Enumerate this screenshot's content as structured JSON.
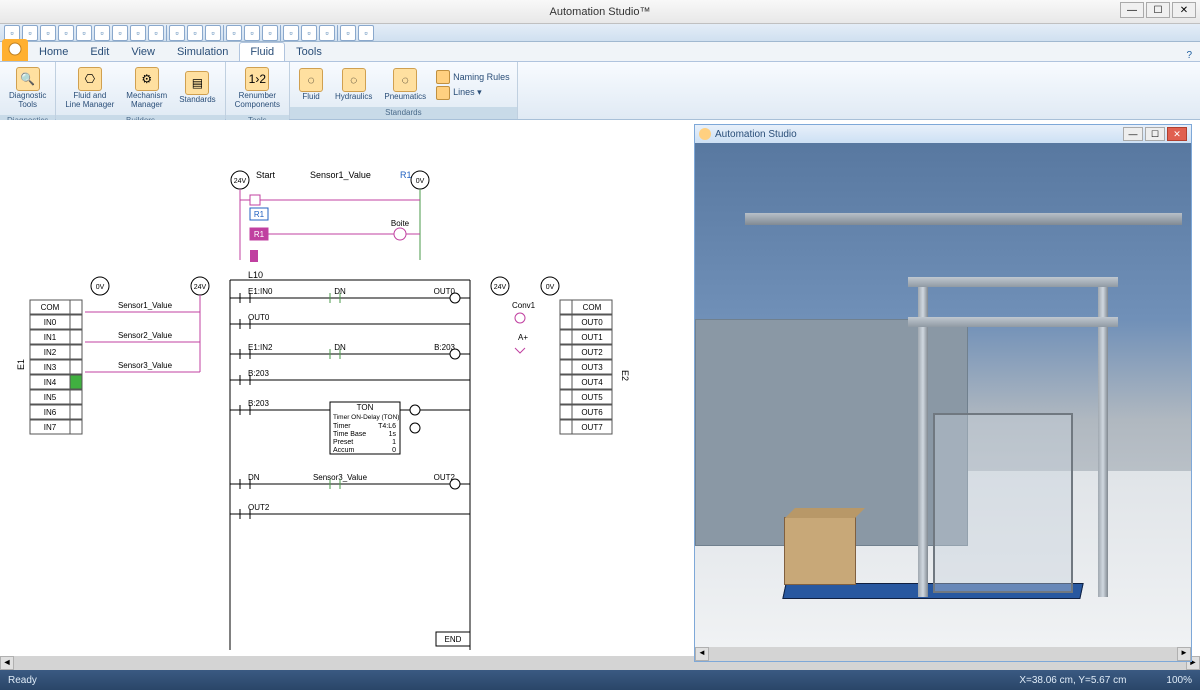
{
  "app": {
    "title": "Automation Studio™"
  },
  "window_controls": {
    "min": "—",
    "max": "☐",
    "close": "✕"
  },
  "qat_icons": [
    "new",
    "open",
    "save",
    "undo",
    "redo",
    "cut",
    "copy",
    "paste",
    "print",
    "sep",
    "zoom",
    "fit",
    "pan",
    "sep",
    "layer",
    "grid",
    "snap",
    "sep",
    "sim",
    "play",
    "stop",
    "sep",
    "opt",
    "help"
  ],
  "tabs": {
    "items": [
      "Home",
      "Edit",
      "View",
      "Simulation",
      "Fluid",
      "Tools"
    ],
    "active": "Fluid"
  },
  "ribbon": {
    "groups": [
      {
        "label": "Diagnostics",
        "buttons": [
          {
            "txt": "Diagnostic\nTools",
            "ico": "🔍"
          }
        ]
      },
      {
        "label": "Builders",
        "buttons": [
          {
            "txt": "Fluid and\nLine Manager",
            "ico": "⎔"
          },
          {
            "txt": "Mechanism\nManager",
            "ico": "⚙"
          },
          {
            "txt": "Standards",
            "ico": "▤"
          }
        ]
      },
      {
        "label": "Tools",
        "buttons": [
          {
            "txt": "Renumber\nComponents",
            "ico": "1›2"
          }
        ]
      },
      {
        "label": "Standards",
        "buttons": [
          {
            "txt": "Fluid",
            "ico": "◌"
          },
          {
            "txt": "Hydraulics",
            "ico": "◌"
          },
          {
            "txt": "Pneumatics",
            "ico": "◌"
          }
        ],
        "small": [
          {
            "txt": "Naming Rules",
            "ico": ""
          },
          {
            "txt": "Lines ▾",
            "ico": ""
          }
        ]
      }
    ]
  },
  "relay_panel": {
    "title": "Automation Studio"
  },
  "ladder": {
    "top": {
      "v24": "24V",
      "v0": "0V",
      "start": "Start",
      "sensor1": "Sensor1_Value",
      "r1": "R1",
      "boite": "Boite"
    },
    "module_left": {
      "title": "E1",
      "rows": [
        "COM",
        "IN0",
        "IN1",
        "IN2",
        "IN3",
        "IN4",
        "IN5",
        "IN6",
        "IN7"
      ],
      "sensors": [
        "Sensor1_Value",
        "Sensor2_Value",
        "Sensor3_Value"
      ]
    },
    "module_right": {
      "title": "E2",
      "rows": [
        "COM",
        "OUT0",
        "OUT1",
        "OUT2",
        "OUT3",
        "OUT4",
        "OUT5",
        "OUT6",
        "OUT7"
      ],
      "conv": "Conv1",
      "aplus": "A+"
    },
    "main": {
      "title": "L10",
      "rungs": [
        {
          "left": "E1:IN0",
          "mid": "DN",
          "right": "OUT0"
        },
        {
          "left": "OUT0"
        },
        {
          "left": "E1:IN2",
          "mid": "DN",
          "right": "B:203"
        },
        {
          "left": "B:203"
        },
        {
          "left": "B:203",
          "block": {
            "title": "TON",
            "name": "Timer ON-Delay (TON)",
            "timer": "T4:L6",
            "timebase": "1s",
            "preset": "1",
            "accum": "0"
          }
        },
        {
          "left": "DN",
          "mid": "Sensor3_Value",
          "right": "OUT2"
        },
        {
          "left": "OUT2"
        }
      ],
      "end": "END"
    }
  },
  "statusbar": {
    "ready": "Ready",
    "coords": "X=38.06 cm, Y=5.67 cm",
    "zoom": "100%"
  },
  "help_icon": "?"
}
